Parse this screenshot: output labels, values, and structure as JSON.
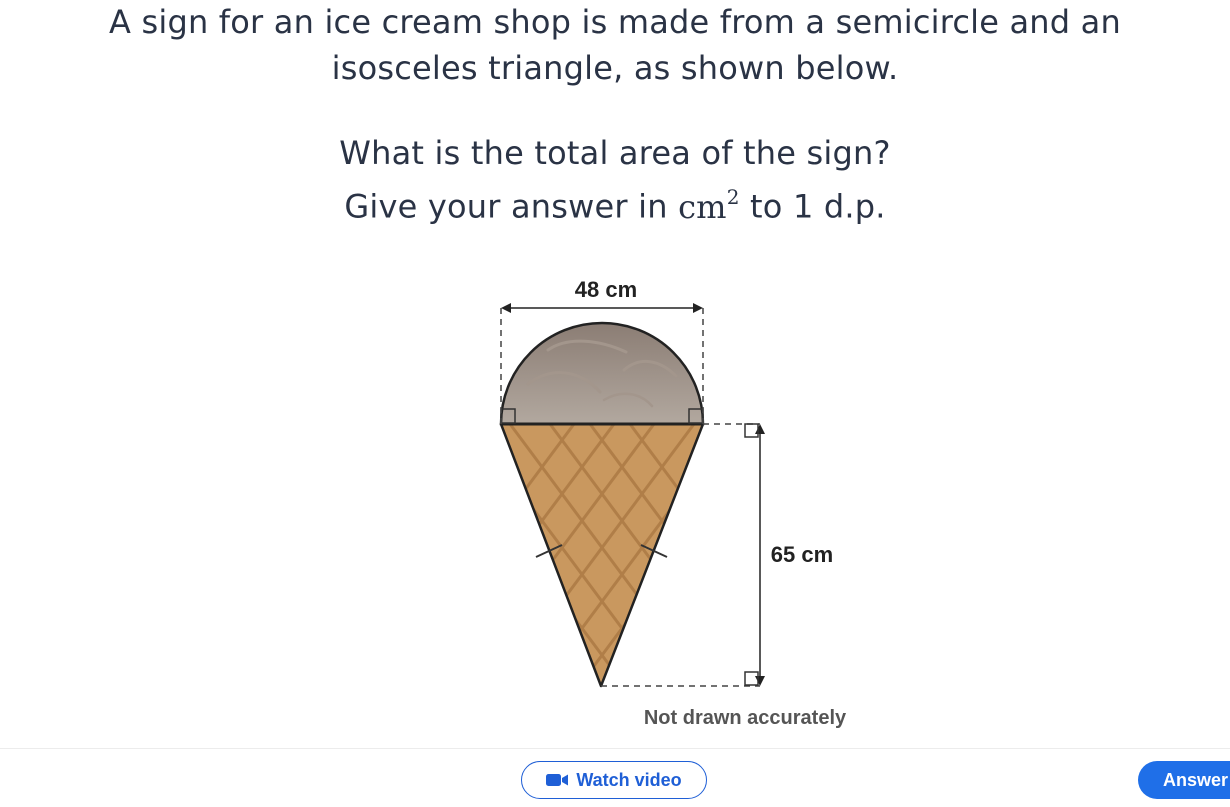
{
  "question": {
    "line1": "A sign for an ice cream shop is made from a semicircle and an",
    "line2": "isosceles triangle, as shown below.",
    "line3": "What is the total area of the sign?",
    "line4_prefix": "Give your answer in ",
    "line4_unit": "cm",
    "line4_exponent": "2",
    "line4_suffix": " to 1 d.p."
  },
  "figure": {
    "width_label": "48 cm",
    "height_label": "65 cm",
    "note": "Not drawn accurately",
    "colors": {
      "scoop_top": "#8b7d74",
      "scoop_bottom": "#b2a89f",
      "cone": "#c9985f",
      "cone_lines": "#b07e48",
      "outline": "#222222"
    }
  },
  "footer": {
    "watch_video_label": "Watch video",
    "answer_label": "Answer",
    "accent": "#1f6fe8"
  }
}
